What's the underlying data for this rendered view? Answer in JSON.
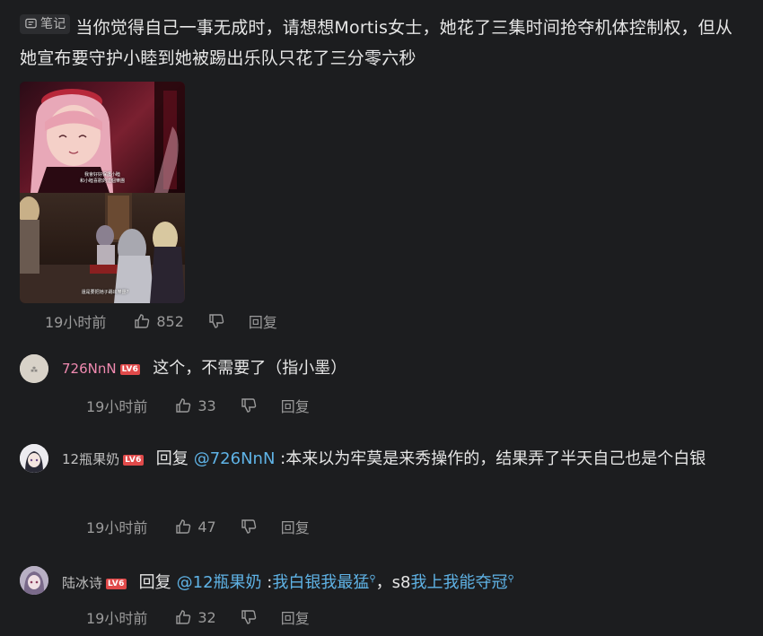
{
  "main_post": {
    "tag": "笔记",
    "text": "当你觉得自己一事无成时，请想想Mortis女士，她花了三集时间抢夺机体控制权，但从她宣布要守护小睦到她被踢出乐队只花了三分零六秒",
    "image": {
      "subtitle_top_1": "我會好好保護小睦",
      "subtitle_top_2": "和小睦喜歡的這個樂團",
      "subtitle_bottom": "還是要把她子踢出樂團?"
    },
    "time": "19小时前",
    "likes": "852",
    "reply_label": "回复"
  },
  "comments": [
    {
      "username": "726NnN",
      "username_color": "#f08ab0",
      "level": "LV6",
      "text": "这个，不需要了（指小墨）",
      "time": "19小时前",
      "likes": "33",
      "reply_label": "回复"
    },
    {
      "username": "12瓶果奶",
      "username_color": "#bfbfbf",
      "level": "LV6",
      "reply_prefix": "回复",
      "mention": "@726NnN",
      "text": " :本来以为牢莫是来秀操作的，结果弄了半天自己也是个白银",
      "time": "19小时前",
      "likes": "47",
      "reply_label": "回复"
    },
    {
      "username": "陆冰诗",
      "username_color": "#bfbfbf",
      "level": "LV6",
      "reply_prefix": "回复",
      "mention": "@12瓶果奶",
      "text_1": " :",
      "keyword_1": "我白银我最猛",
      "text_2": "，s8",
      "keyword_2": "我上我能夺冠",
      "time": "19小时前",
      "likes": "32",
      "reply_label": "回复"
    }
  ],
  "colors": {
    "background": "#1c1d1f",
    "mention": "#5fb3e6",
    "level_badge": "#e04a4a",
    "meta_text": "#9a9a9a"
  },
  "icons": [
    "note-icon",
    "thumbs-up-icon",
    "thumbs-down-icon",
    "search-icon"
  ]
}
